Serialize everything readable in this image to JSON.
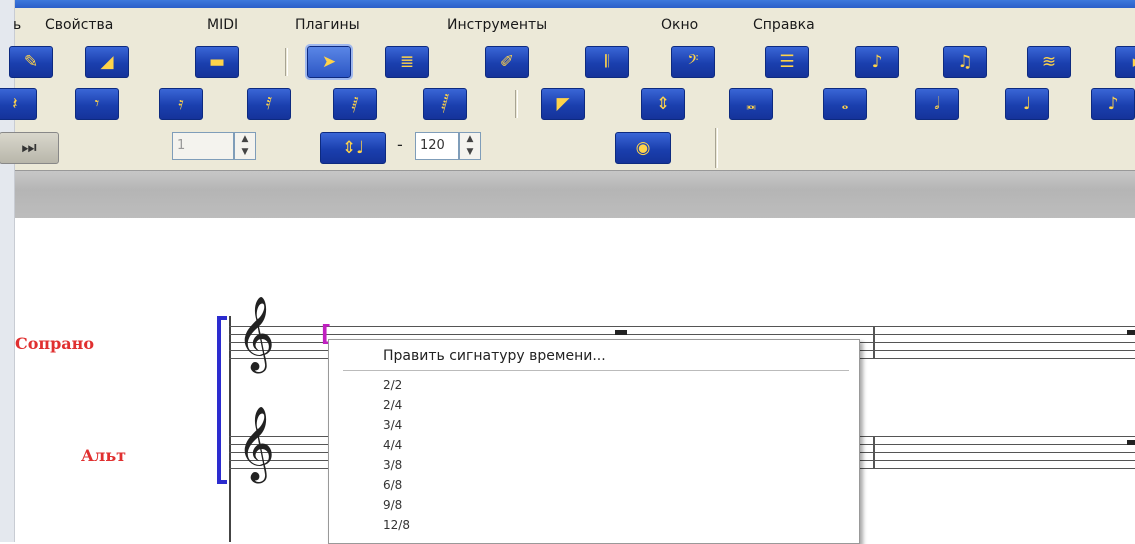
{
  "menubar": {
    "items": [
      "Свойства",
      "MIDI",
      "Плагины",
      "Инструменты",
      "Окно",
      "Справка"
    ]
  },
  "toolbar": {
    "row1_icons": [
      "eraser-icon",
      "palette-icon",
      "keyboard-icon",
      "select-arrow-icon",
      "staff-icon",
      "pencil-icon",
      "bar-icon",
      "bass-clef-icon",
      "lines-icon",
      "eighth-note-icon",
      "beamed-notes-icon",
      "stack-icon"
    ],
    "row2_icons": [
      "eighth-rest-icon",
      "sixteenth-rest-icon",
      "32nd-rest-icon",
      "64th-rest-icon",
      "128th-rest-icon",
      "256th-rest-icon",
      "eraser-tool-icon",
      "up-down-icon",
      "breve-icon",
      "whole-note-icon",
      "half-note-icon",
      "quarter-note-icon",
      "eighth-note-icon"
    ],
    "measure_field": "1",
    "tempo_separator": "-",
    "tempo_value": "120"
  },
  "score": {
    "instruments": [
      "Сопрано",
      "Альт"
    ]
  },
  "context_menu": {
    "header": "Править сигнатуру времени...",
    "items": [
      "2/2",
      "2/4",
      "3/4",
      "4/4",
      "3/8",
      "6/8",
      "9/8",
      "12/8"
    ]
  },
  "colors": {
    "toolbar_button": "#1a3fae",
    "instrument_label": "#e03030",
    "brace": "#2c2ccf"
  }
}
